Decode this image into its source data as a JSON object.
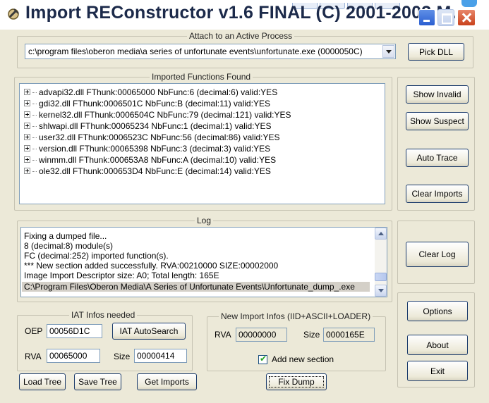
{
  "window": {
    "title": "Import REConstructor v1.6 FINAL (C) 2001-2003 M...",
    "icon": "app-icon"
  },
  "attach": {
    "legend": "Attach to an Active Process",
    "process_value": "c:\\program files\\oberon media\\a series of unfortunate events\\unfortunate.exe (0000050C)",
    "pick_dll": "Pick DLL"
  },
  "imports": {
    "legend": "Imported Functions Found",
    "items": [
      "advapi32.dll FThunk:00065000 NbFunc:6 (decimal:6) valid:YES",
      "gdi32.dll FThunk:0006501C NbFunc:B (decimal:11) valid:YES",
      "kernel32.dll FThunk:0006504C NbFunc:79 (decimal:121) valid:YES",
      "shlwapi.dll FThunk:00065234 NbFunc:1 (decimal:1) valid:YES",
      "user32.dll FThunk:0006523C NbFunc:56 (decimal:86) valid:YES",
      "version.dll FThunk:00065398 NbFunc:3 (decimal:3) valid:YES",
      "winmm.dll FThunk:000653A8 NbFunc:A (decimal:10) valid:YES",
      "ole32.dll FThunk:000653D4 NbFunc:E (decimal:14) valid:YES"
    ]
  },
  "side_buttons": {
    "show_invalid": "Show Invalid",
    "show_suspect": "Show Suspect",
    "auto_trace": "Auto Trace",
    "clear_imports": "Clear Imports",
    "clear_log": "Clear Log",
    "options": "Options",
    "about": "About",
    "exit": "Exit"
  },
  "log": {
    "legend": "Log",
    "lines": [
      "Fixing a dumped file...",
      "8 (decimal:8) module(s)",
      "FC (decimal:252) imported function(s).",
      "*** New section added successfully. RVA:00210000 SIZE:00002000",
      "Image Import Descriptor size: A0; Total length: 165E",
      "C:\\Program Files\\Oberon Media\\A Series of Unfortunate Events\\Unfortunate_dump_.exe"
    ]
  },
  "iat": {
    "legend": "IAT Infos needed",
    "oep_label": "OEP",
    "oep_value": "00056D1C",
    "autosearch": "IAT AutoSearch",
    "rva_label": "RVA",
    "rva_value": "00065000",
    "size_label": "Size",
    "size_value": "00000414"
  },
  "new_import": {
    "legend": "New Import Infos (IID+ASCII+LOADER)",
    "rva_label": "RVA",
    "rva_value": "00000000",
    "size_label": "Size",
    "size_value": "0000165E",
    "add_section_label": "Add new section",
    "add_section_checked": true
  },
  "bottom_buttons": {
    "load_tree": "Load Tree",
    "save_tree": "Save Tree",
    "get_imports": "Get Imports",
    "fix_dump": "Fix Dump"
  }
}
